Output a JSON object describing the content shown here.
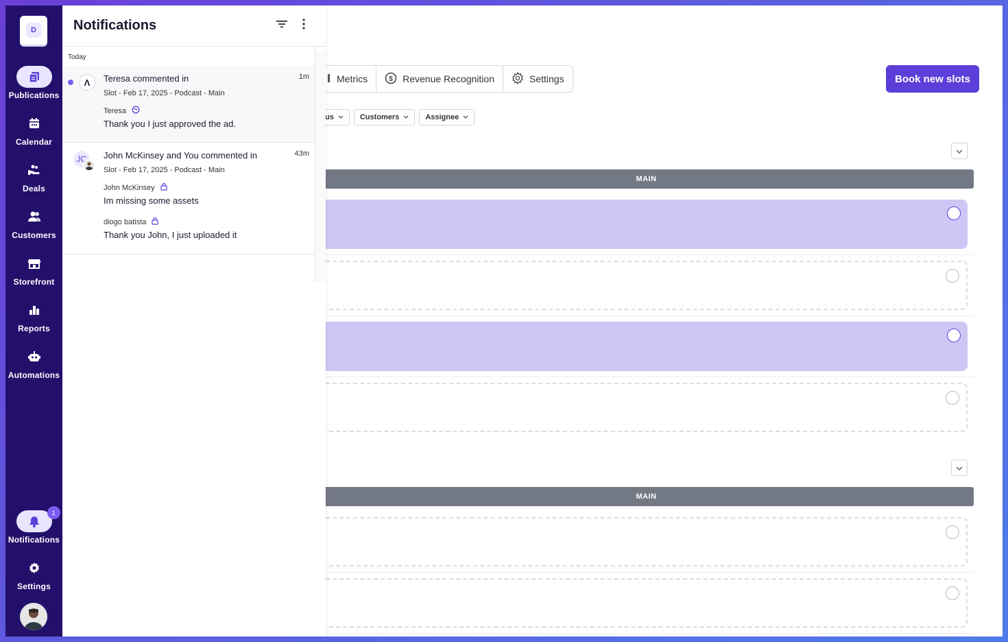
{
  "sidebar": {
    "logo_letter": "D",
    "items": [
      {
        "label": "Publications",
        "icon": "publications-icon"
      },
      {
        "label": "Calendar",
        "icon": "calendar-icon"
      },
      {
        "label": "Deals",
        "icon": "deals-icon"
      },
      {
        "label": "Customers",
        "icon": "customers-icon"
      },
      {
        "label": "Storefront",
        "icon": "storefront-icon"
      },
      {
        "label": "Reports",
        "icon": "reports-icon"
      },
      {
        "label": "Automations",
        "icon": "automations-icon"
      }
    ],
    "notifications_label": "Notifications",
    "notifications_badge": "1",
    "settings_label": "Settings"
  },
  "notifications": {
    "title": "Notifications",
    "section": "Today",
    "items": [
      {
        "headline": "Teresa commented in",
        "time": "1m",
        "subject": "Slot - Feb 17, 2025 - Podcast - Main",
        "comments": [
          {
            "author": "Teresa",
            "text": "Thank you I just approved the ad.",
            "visibility": "globe-icon"
          }
        ],
        "unread": true,
        "avatar_glyph": "Λ"
      },
      {
        "headline": "John McKinsey and You commented in",
        "time": "43m",
        "subject": "Slot - Feb 17, 2025 - Podcast - Main",
        "comments": [
          {
            "author": "John McKinsey",
            "text": "Im missing some assets",
            "visibility": "lock-icon"
          },
          {
            "author": "diogo batista",
            "text": "Thank you John, I just uploaded it",
            "visibility": "lock-icon"
          }
        ],
        "unread": false,
        "avatar_initials": "JC"
      }
    ]
  },
  "main": {
    "tabs": [
      {
        "label": "Metrics",
        "icon": "metrics-icon"
      },
      {
        "label": "Revenue Recognition",
        "icon": "dollar-circle-icon"
      },
      {
        "label": "Settings",
        "icon": "gear-icon"
      }
    ],
    "book_button": "Book new slots",
    "filters": [
      "us",
      "Customers",
      "Assignee"
    ],
    "groups": [
      {
        "label": "MAIN"
      },
      {
        "label": "MAIN"
      }
    ]
  },
  "colors": {
    "sidebar": "#23106b",
    "accent": "#5b3fd8",
    "slot_filled": "#cec6f5",
    "group_bar": "#737885"
  }
}
